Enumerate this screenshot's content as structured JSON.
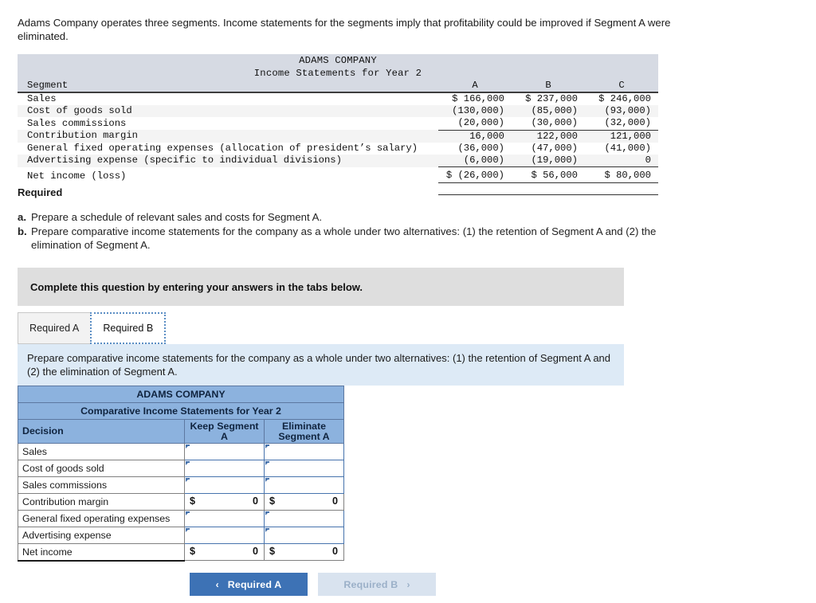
{
  "intro": {
    "text": "Adams Company operates three segments. Income statements for the segments imply that profitability could be improved if Segment A were eliminated."
  },
  "exhibit": {
    "company": "ADAMS COMPANY",
    "statement_title": "Income Statements for Year 2",
    "row_header": "Segment",
    "columns": [
      "A",
      "B",
      "C"
    ],
    "rows": [
      {
        "label": "Sales",
        "a": "$ 166,000",
        "b": "$ 237,000",
        "c": "$ 246,000"
      },
      {
        "label": "Cost of goods sold",
        "a": "(130,000)",
        "b": "(85,000)",
        "c": "(93,000)"
      },
      {
        "label": "Sales commissions",
        "a": "(20,000)",
        "b": "(30,000)",
        "c": "(32,000)"
      },
      {
        "label": "Contribution margin",
        "a": "16,000",
        "b": "122,000",
        "c": "121,000"
      },
      {
        "label": "General fixed operating expenses (allocation of president’s salary)",
        "a": "(36,000)",
        "b": "(47,000)",
        "c": "(41,000)"
      },
      {
        "label": "Advertising expense (specific to individual divisions)",
        "a": "(6,000)",
        "b": "(19,000)",
        "c": "0"
      },
      {
        "label": "Net income (loss)",
        "a": "$ (26,000)",
        "b": "$ 56,000",
        "c": "$ 80,000"
      }
    ]
  },
  "required": {
    "heading": "Required",
    "items": [
      {
        "mark": "a.",
        "text": "Prepare a schedule of relevant sales and costs for Segment A."
      },
      {
        "mark": "b.",
        "text": "Prepare comparative income statements for the company as a whole under two alternatives: (1) the retention of Segment A and (2) the elimination of Segment A."
      }
    ]
  },
  "banner": {
    "text": "Complete this question by entering your answers in the tabs below."
  },
  "tabs": [
    {
      "label": "Required A",
      "active": false
    },
    {
      "label": "Required B",
      "active": true
    }
  ],
  "sub_instruction": {
    "text": "Prepare comparative income statements for the company as a whole under two alternatives: (1) the retention of Segment A and (2) the elimination of Segment A."
  },
  "answer_table": {
    "title_line1": "ADAMS COMPANY",
    "title_line2": "Comparative Income Statements for Year 2",
    "col_label": "Decision",
    "col_keep": "Keep Segment A",
    "col_keep_l1": "Keep Segment",
    "col_keep_l2": "A",
    "col_elim": "Eliminate Segment A",
    "col_elim_l1": "Eliminate",
    "col_elim_l2": "Segment A",
    "rows": [
      {
        "label": "Sales",
        "type": "input"
      },
      {
        "label": "Cost of goods sold",
        "type": "input"
      },
      {
        "label": "Sales commissions",
        "type": "input"
      },
      {
        "label": "Contribution margin",
        "type": "calc",
        "keep_symbol": "$",
        "keep_value": "0",
        "elim_symbol": "$",
        "elim_value": "0"
      },
      {
        "label": "General fixed operating expenses",
        "type": "input"
      },
      {
        "label": "Advertising expense",
        "type": "input"
      },
      {
        "label": "Net income",
        "type": "calc",
        "keep_symbol": "$",
        "keep_value": "0",
        "elim_symbol": "$",
        "elim_value": "0"
      }
    ]
  },
  "nav": {
    "prev_label": "Required A",
    "prev_chevron": "‹",
    "next_label": "Required B",
    "next_chevron": "›"
  },
  "colors": {
    "header_blue": "#8cb2de",
    "input_border": "#4673ad",
    "banner_grey": "#dedede",
    "instruction_blue": "#ddeaf6",
    "button_blue": "#3d72b5",
    "button_disabled": "#d9e3ef"
  }
}
